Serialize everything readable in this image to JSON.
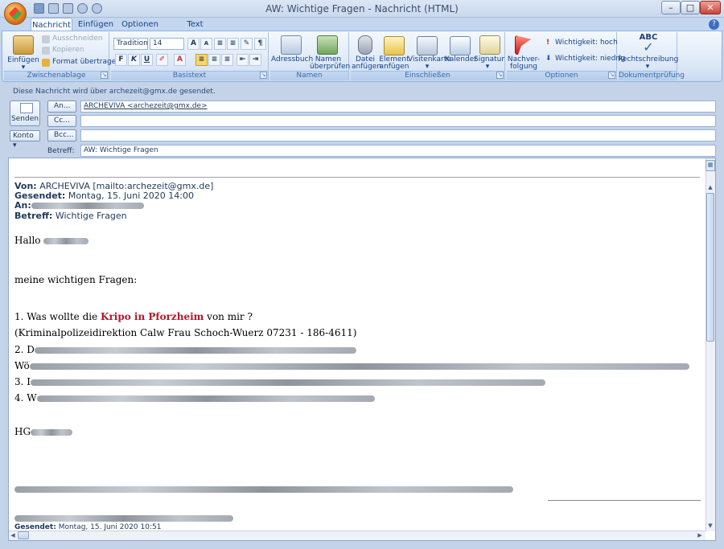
{
  "window": {
    "title": "AW: Wichtige Fragen - Nachricht (HTML)",
    "minimize": "–",
    "maximize": "□",
    "close": "✕"
  },
  "tabs": [
    "Nachricht",
    "Einfügen",
    "Optionen",
    "Text formatieren"
  ],
  "help": "?",
  "ribbon": {
    "clipboard": {
      "label": "Zwischenablage",
      "paste": "Einfügen",
      "cut": "Ausschneiden",
      "copy": "Kopieren",
      "format_painter": "Format übertragen"
    },
    "basic_text": {
      "label": "Basistext",
      "font": "Tradition",
      "size": "14",
      "bold": "F",
      "italic": "K",
      "underline": "U"
    },
    "names": {
      "label": "Namen",
      "address_book": "Adressbuch",
      "check_names_1": "Namen",
      "check_names_2": "überprüfen"
    },
    "include": {
      "label": "Einschließen",
      "attach_file_1": "Datei",
      "attach_file_2": "anfügen",
      "attach_item_1": "Element",
      "attach_item_2": "anfügen",
      "business_card": "Visitenkarte",
      "calendar": "Kalender",
      "signature": "Signatur"
    },
    "options": {
      "label": "Optionen",
      "follow_up_1": "Nachver-",
      "follow_up_2": "folgung",
      "high_importance": "Wichtigkeit: hoch",
      "low_importance": "Wichtigkeit: niedrig"
    },
    "proofing": {
      "label": "Dokumentprüfung",
      "spelling": "Rechtschreibung",
      "abc": "ABC"
    }
  },
  "compose": {
    "send_info": "Diese Nachricht wird über archezeit@gmx.de gesendet.",
    "send_button": "Senden",
    "account_button": "Konto",
    "to_button": "An...",
    "cc_button": "Cc...",
    "bcc_button": "Bcc...",
    "to_value": "ARCHEVIVA <archezeit@gmx.de>",
    "cc_value": "",
    "bcc_value": "",
    "subject_label": "Betreff:",
    "subject_value": "AW: Wichtige Fragen"
  },
  "body": {
    "from_label": "Von:",
    "from_value": "ARCHEVIVA [mailto:archezeit@gmx.de]",
    "sent_label": "Gesendet:",
    "sent_value": "Montag, 15. Juni 2020 14:00",
    "to_label": "An:",
    "subject_label": "Betreff:",
    "subject_value": "Wichtige Fragen",
    "greeting": "Hallo",
    "intro": "meine wichtigen Fragen:",
    "q1_prefix": "1. Was wollte die",
    "q1_highlight": "Kripo in Pforzheim",
    "q1_suffix": "von mir ?",
    "q1_note": "(Kriminalpolizeidirektion Calw Frau Schoch-Wuerz 07231 - 186-4611)",
    "q2_prefix": "2. D",
    "q2_cont": "Wö",
    "q3_prefix": "3. I",
    "q4_prefix": "4. W",
    "sign": "HG",
    "footer_sent_label": "Gesendet:",
    "footer_sent_value": "Montag, 15. Juni 2020 10:51"
  }
}
